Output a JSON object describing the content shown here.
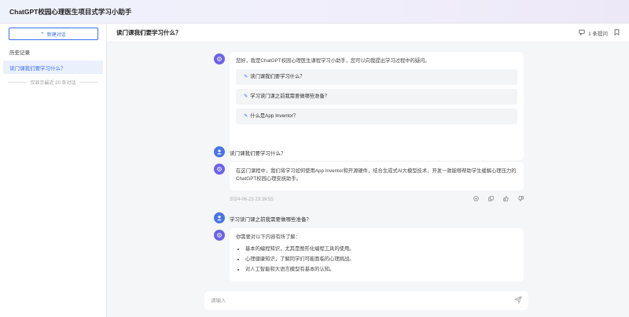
{
  "app": {
    "title": "ChatGPT校园心理医生项目式学习小助手"
  },
  "sidebar": {
    "new_chat_label": "新建对话",
    "history_title": "历史记录",
    "history_items": [
      {
        "label": "读门课我们要学习什么？"
      }
    ],
    "history_note": "仅显示最近 20 条对话"
  },
  "conversation": {
    "title": "读门课我们要学习什么？",
    "question_count_label": "1 条提问"
  },
  "messages": {
    "welcome": {
      "text": "您好，我是ChatGPT校园心理医生课程学习小助手，您可以向我提出学习过程中的疑问。",
      "suggestions": [
        "读门课我们要学习什么？",
        "学习读门课之前我需要做哪些准备？",
        "什么是App Inventor？"
      ]
    },
    "user1": {
      "text": "读门课我们要学习什么？"
    },
    "bot1": {
      "text": "在这门课程中，我们将学习如何使用App Inventor和开源硬件，结合生成式AI大模型技术，开发一款能够帮助学生缓解心理压力的ChatGPT校园心理安抚助手。",
      "timestamp": "2024-06-23 23:39:55"
    },
    "user2": {
      "text": "学习读门课之前我需要做哪些准备？"
    },
    "bot2": {
      "intro": "你需要对以下内容有所了解：",
      "bullets": [
        "基本的编程知识，尤其是图形化编程工具的使用。",
        "心理健康知识，了解同学们可能面临的心理挑战。",
        "对人工智能和大语言模型有基本的认知。"
      ]
    }
  },
  "input": {
    "placeholder": "请输入"
  },
  "colors": {
    "accent": "#3b6ef5",
    "bot_avatar": "#6c62e8",
    "user_avatar": "#4a73e8"
  }
}
